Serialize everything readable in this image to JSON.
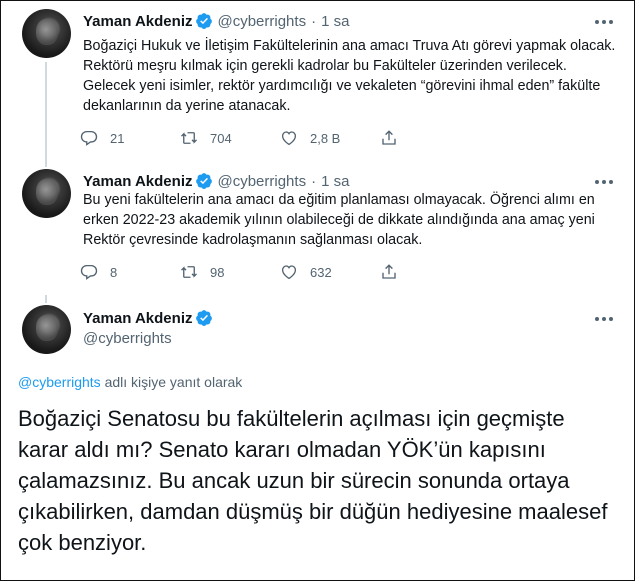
{
  "brand": {
    "accent": "#1d9bf0",
    "text": "#0f1419",
    "muted": "#536471",
    "line": "#cfd9de"
  },
  "tweets": [
    {
      "name": "Yaman Akdeniz",
      "handle": "@cyberrights",
      "separator": "·",
      "time": "1 sa",
      "text": "Boğaziçi Hukuk ve İletişim Fakültelerinin ana amacı Truva Atı görevi yapmak olacak. Rektörü meşru kılmak için gerekli kadrolar bu Fakülteler üzerinden verilecek. Gelecek yeni isimler, rektör yardımcılığı ve vekaleten “görevini ihmal eden” fakülte dekanlarının da yerine atanacak.",
      "replies": "21",
      "retweets": "704",
      "likes": "2,8 B"
    },
    {
      "name": "Yaman Akdeniz",
      "handle": "@cyberrights",
      "separator": "·",
      "time": "1 sa",
      "text": "Bu yeni fakültelerin ana amacı da eğitim planlaması olmayacak. Öğrenci alımı en erken 2022-23 akademik yılının olabileceği de dikkate alındığında ana amaç yeni Rektör çevresinde kadrolaşmanın sağlanması olacak.",
      "replies": "8",
      "retweets": "98",
      "likes": "632"
    }
  ],
  "focused": {
    "name": "Yaman Akdeniz",
    "handle": "@cyberrights",
    "reply_link": "@cyberrights",
    "reply_suffix": " adlı kişiye yanıt olarak",
    "text": "Boğaziçi Senatosu bu fakültelerin açılması için geçmişte karar aldı mı? Senato kararı olmadan YÖK’ün kapısını çalamazsınız. Bu ancak uzun bir sürecin sonunda ortaya çıkabilirken, damdan düşmüş bir düğün hediyesine maalesef çok benziyor."
  },
  "icons": {
    "verified": "verified-badge-icon",
    "reply": "reply-icon",
    "retweet": "retweet-icon",
    "like": "heart-icon",
    "share": "share-icon",
    "more": "more-icon"
  }
}
